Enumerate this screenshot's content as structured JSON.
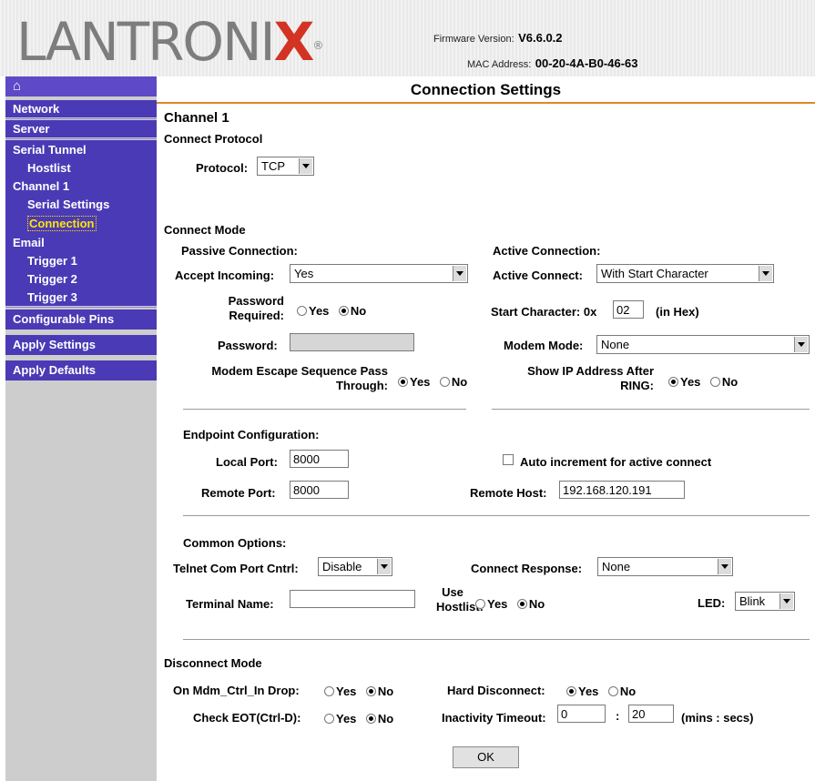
{
  "header": {
    "logo_text": "LANTRONI",
    "logo_x": "X",
    "logo_reg": "®",
    "firmware_label": "Firmware Version:",
    "firmware_value": "V6.6.0.2",
    "mac_label": "MAC Address:",
    "mac_value": "00-20-4A-B0-46-63"
  },
  "sidebar": {
    "home_icon": "⌂",
    "items": [
      {
        "label": "Network"
      },
      {
        "label": "Server"
      },
      {
        "label": "Serial Tunnel"
      },
      {
        "label": "Hostlist"
      },
      {
        "label": "Channel 1"
      },
      {
        "label": "Serial Settings"
      },
      {
        "label": "Connection"
      },
      {
        "label": "Email"
      },
      {
        "label": "Trigger 1"
      },
      {
        "label": "Trigger 2"
      },
      {
        "label": "Trigger 3"
      },
      {
        "label": "Configurable Pins"
      },
      {
        "label": "Apply Settings"
      },
      {
        "label": "Apply Defaults"
      }
    ]
  },
  "page_title": "Connection Settings",
  "channel_title": "Channel 1",
  "connect_protocol": {
    "heading": "Connect Protocol",
    "protocol_label": "Protocol:",
    "protocol_value": "TCP"
  },
  "connect_mode": {
    "heading": "Connect Mode",
    "passive_heading": "Passive Connection:",
    "active_heading": "Active Connection:",
    "accept_incoming_label": "Accept Incoming:",
    "accept_incoming_value": "Yes",
    "active_connect_label": "Active Connect:",
    "active_connect_value": "With Start Character",
    "password_required_label_1": "Password",
    "password_required_label_2": "Required:",
    "password_required_value": "No",
    "start_char_label": "Start Character: 0x",
    "start_char_value": "02",
    "start_char_hint": "(in Hex)",
    "password_label": "Password:",
    "password_value": "",
    "modem_mode_label": "Modem Mode:",
    "modem_mode_value": "None",
    "modem_escape_label_1": "Modem Escape Sequence Pass",
    "modem_escape_label_2": "Through:",
    "modem_escape_value": "Yes",
    "show_ip_label_1": "Show IP Address After",
    "show_ip_label_2": "RING:",
    "show_ip_value": "Yes",
    "yes": "Yes",
    "no": "No"
  },
  "endpoint": {
    "heading": "Endpoint Configuration:",
    "local_port_label": "Local Port:",
    "local_port_value": "8000",
    "auto_increment_label": "Auto increment for active connect",
    "auto_increment_checked": false,
    "remote_port_label": "Remote Port:",
    "remote_port_value": "8000",
    "remote_host_label": "Remote Host:",
    "remote_host_value": "192.168.120.191"
  },
  "common": {
    "heading": "Common Options:",
    "telnet_label": "Telnet Com Port Cntrl:",
    "telnet_value": "Disable",
    "connect_response_label": "Connect Response:",
    "connect_response_value": "None",
    "terminal_name_label": "Terminal Name:",
    "terminal_name_value": "",
    "use_hostlist_label_1": "Use",
    "use_hostlist_label_2": "Hostlist:",
    "use_hostlist_value": "No",
    "led_label": "LED:",
    "led_value": "Blink"
  },
  "disconnect": {
    "heading": "Disconnect Mode",
    "mdm_ctrl_label": "On Mdm_Ctrl_In Drop:",
    "mdm_ctrl_value": "No",
    "hard_disconnect_label": "Hard Disconnect:",
    "hard_disconnect_value": "Yes",
    "check_eot_label": "Check EOT(Ctrl-D):",
    "check_eot_value": "No",
    "inactivity_label": "Inactivity Timeout:",
    "inactivity_mins": "0",
    "inactivity_colon": ":",
    "inactivity_secs": "20",
    "inactivity_units": "(mins : secs)"
  },
  "ok_button": "OK"
}
